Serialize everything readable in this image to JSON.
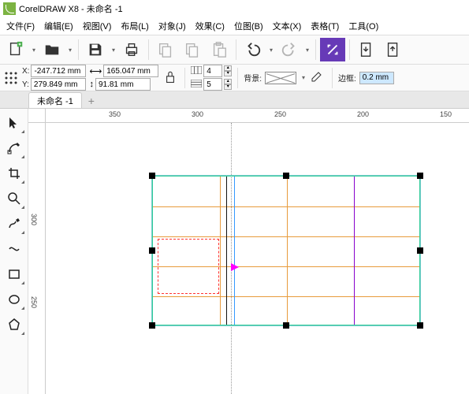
{
  "title": "CorelDRAW X8 - 未命名 -1",
  "menu": [
    "文件(F)",
    "编辑(E)",
    "视图(V)",
    "布局(L)",
    "对象(J)",
    "效果(C)",
    "位图(B)",
    "文本(X)",
    "表格(T)",
    "工具(O)"
  ],
  "tab": {
    "name": "未命名 -1"
  },
  "props": {
    "x": "-247.712 mm",
    "y": "279.849 mm",
    "w": "165.047 mm",
    "h": "91.81 mm",
    "cols": "4",
    "rows": "5",
    "bg_label": "背景:",
    "border_label": "边框:",
    "border_val": "0.2 mm"
  },
  "ruler_h": [
    "350",
    "300",
    "250",
    "200",
    "150"
  ],
  "ruler_v": [
    "300",
    "250"
  ]
}
